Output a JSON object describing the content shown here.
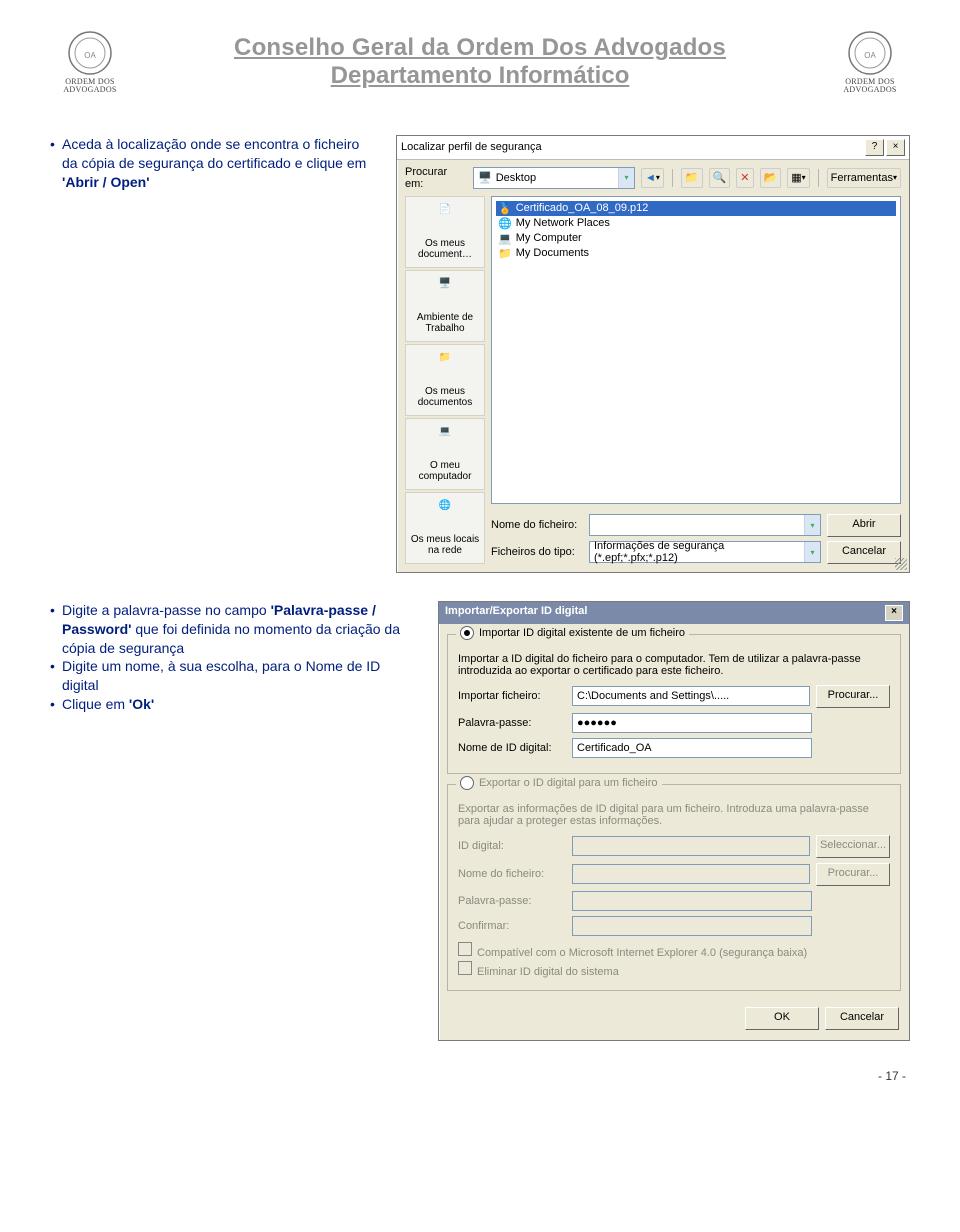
{
  "header": {
    "line1": "Conselho Geral da Ordem Dos Advogados",
    "line2": "Departamento Informático",
    "logo_text1": "ORDEM DOS",
    "logo_text2": "ADVOGADOS"
  },
  "instr1": {
    "text_a": "Aceda à localização onde se encontra o ficheiro da cópia de segurança do certificado e clique em ",
    "text_b": "'Abrir / Open'"
  },
  "dialog1": {
    "title": "Localizar perfil de segurança",
    "help": "?",
    "close": "×",
    "look_in_label": "Procurar em:",
    "look_in_value": "Desktop",
    "tools_label": "Ferramentas",
    "nav": {
      "back": "◄",
      "up": "▲",
      "search": "🔍",
      "del": "✕",
      "new": "📁",
      "views": "▦"
    },
    "places": [
      {
        "name": "Os meus document…",
        "icon": "docs"
      },
      {
        "name": "Ambiente de Trabalho",
        "icon": "desktop"
      },
      {
        "name": "Os meus documentos",
        "icon": "folder"
      },
      {
        "name": "O meu computador",
        "icon": "computer"
      },
      {
        "name": "Os meus locais na rede",
        "icon": "network"
      }
    ],
    "files": [
      {
        "name": "Certificado_OA_08_09.p12",
        "selected": true,
        "icon": "cert"
      },
      {
        "name": "My Network Places",
        "icon": "net"
      },
      {
        "name": "My Computer",
        "icon": "pc"
      },
      {
        "name": "My Documents",
        "icon": "mydoc"
      }
    ],
    "filename_label": "Nome do ficheiro:",
    "filename_value": "",
    "filetype_label": "Ficheiros do tipo:",
    "filetype_value": "Informações de segurança (*.epf;*.pfx;*.p12)",
    "open_btn": "Abrir",
    "cancel_btn": "Cancelar"
  },
  "instr2": {
    "items": [
      {
        "pre": "Digite a palavra-passe no campo ",
        "b1": "'Palavra-passe / Password'",
        "post": " que foi definida no momento da criação da cópia de segurança"
      },
      {
        "pre": "Digite um nome, à sua escolha, para o Nome de ID digital"
      },
      {
        "pre": "Clique em ",
        "b1": "'Ok'"
      }
    ]
  },
  "dialog2": {
    "title": "Importar/Exportar ID digital",
    "close": "×",
    "g1_legend": "Importar ID digital existente de um ficheiro",
    "g1_desc": "Importar a ID digital do ficheiro para o computador. Tem de utilizar a palavra-passe introduzida ao exportar o certificado para este ficheiro.",
    "import_file_label": "Importar ficheiro:",
    "import_file_value": "C:\\Documents and Settings\\.....",
    "browse_btn": "Procurar...",
    "password_label": "Palavra-passe:",
    "password_value": "●●●●●●",
    "idname_label": "Nome de ID digital:",
    "idname_value": "Certificado_OA",
    "g2_legend": "Exportar o ID digital para um ficheiro",
    "g2_desc": "Exportar as informações de ID digital para um ficheiro. Introduza uma palavra-passe para ajudar a proteger estas informações.",
    "iddigital_label": "ID digital:",
    "select_btn": "Seleccionar...",
    "filename_label": "Nome do ficheiro:",
    "browse2_btn": "Procurar...",
    "password2_label": "Palavra-passe:",
    "confirm_label": "Confirmar:",
    "chk1": "Compatível com o Microsoft Internet Explorer 4.0 (segurança baixa)",
    "chk2": "Eliminar ID digital do sistema",
    "ok": "OK",
    "cancel": "Cancelar"
  },
  "page_number": "- 17 -"
}
